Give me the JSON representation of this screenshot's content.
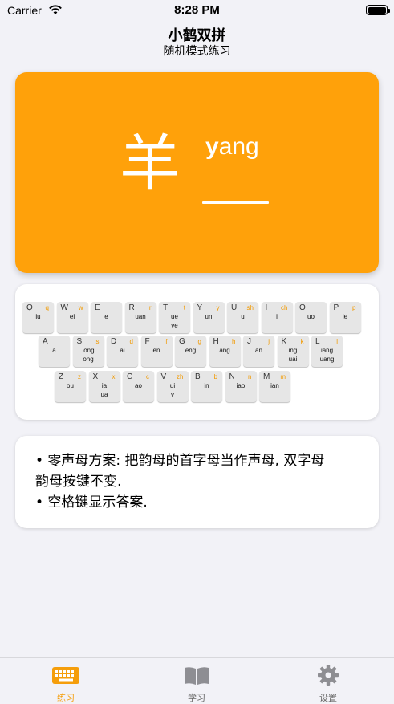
{
  "status": {
    "carrier": "Carrier",
    "time": "8:28 PM"
  },
  "header": {
    "title": "小鹤双拼",
    "subtitle": "随机模式练习"
  },
  "card": {
    "hanzi": "羊",
    "pinyin_first": "y",
    "pinyin_rest": "ang"
  },
  "keyboard": {
    "rows": [
      [
        {
          "upper": "Q",
          "initial": "q",
          "finals": [
            "iu"
          ]
        },
        {
          "upper": "W",
          "initial": "w",
          "finals": [
            "ei"
          ]
        },
        {
          "upper": "E",
          "initial": "",
          "finals": [
            "e"
          ]
        },
        {
          "upper": "R",
          "initial": "r",
          "finals": [
            "uan"
          ]
        },
        {
          "upper": "T",
          "initial": "t",
          "finals": [
            "ue",
            "ve"
          ]
        },
        {
          "upper": "Y",
          "initial": "y",
          "finals": [
            "un"
          ]
        },
        {
          "upper": "U",
          "initial": "sh",
          "finals": [
            "u"
          ]
        },
        {
          "upper": "I",
          "initial": "ch",
          "finals": [
            "i"
          ]
        },
        {
          "upper": "O",
          "initial": "",
          "finals": [
            "uo"
          ]
        },
        {
          "upper": "P",
          "initial": "p",
          "finals": [
            "ie"
          ]
        }
      ],
      [
        {
          "upper": "A",
          "initial": "",
          "finals": [
            "a"
          ]
        },
        {
          "upper": "S",
          "initial": "s",
          "finals": [
            "iong",
            "ong"
          ]
        },
        {
          "upper": "D",
          "initial": "d",
          "finals": [
            "ai"
          ]
        },
        {
          "upper": "F",
          "initial": "f",
          "finals": [
            "en"
          ]
        },
        {
          "upper": "G",
          "initial": "g",
          "finals": [
            "eng"
          ]
        },
        {
          "upper": "H",
          "initial": "h",
          "finals": [
            "ang"
          ]
        },
        {
          "upper": "J",
          "initial": "j",
          "finals": [
            "an"
          ]
        },
        {
          "upper": "K",
          "initial": "k",
          "finals": [
            "ing",
            "uai"
          ]
        },
        {
          "upper": "L",
          "initial": "l",
          "finals": [
            "iang",
            "uang"
          ]
        }
      ],
      [
        {
          "upper": "Z",
          "initial": "z",
          "finals": [
            "ou"
          ]
        },
        {
          "upper": "X",
          "initial": "x",
          "finals": [
            "ia",
            "ua"
          ]
        },
        {
          "upper": "C",
          "initial": "c",
          "finals": [
            "ao"
          ]
        },
        {
          "upper": "V",
          "initial": "zh",
          "finals": [
            "ui",
            "v"
          ]
        },
        {
          "upper": "B",
          "initial": "b",
          "finals": [
            "in"
          ]
        },
        {
          "upper": "N",
          "initial": "n",
          "finals": [
            "iao"
          ]
        },
        {
          "upper": "M",
          "initial": "m",
          "finals": [
            "ian"
          ]
        }
      ]
    ]
  },
  "info": {
    "lines": [
      "• 零声母方案: 把韵母的首字母当作声母, 双字母",
      "韵母按键不变.",
      "• 空格键显示答案."
    ]
  },
  "tabs": [
    {
      "label": "练习",
      "icon": "keyboard-icon",
      "active": true
    },
    {
      "label": "学习",
      "icon": "book-icon",
      "active": false
    },
    {
      "label": "设置",
      "icon": "gear-icon",
      "active": false
    }
  ],
  "colors": {
    "accent": "#ffa10a",
    "tab_active": "#f59e0b",
    "background": "#f2f2f7"
  }
}
